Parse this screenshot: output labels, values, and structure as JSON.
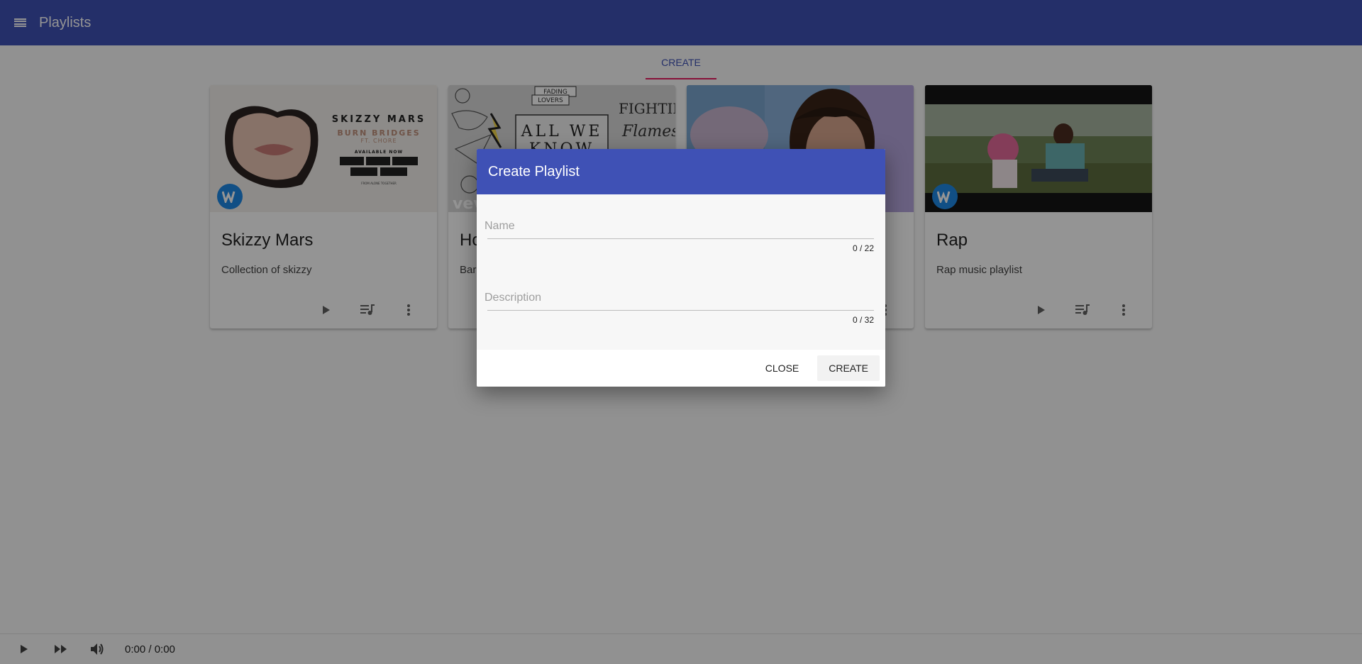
{
  "appbar": {
    "title": "Playlists",
    "menu_icon": "menu-icon"
  },
  "tabs": [
    {
      "label": "CREATE",
      "active": true
    }
  ],
  "cards": [
    {
      "title": "Skizzy Mars",
      "description": "Collection of skizzy",
      "art": {
        "heading": "SKIZZY MARS",
        "sub1": "BURN BRIDGES",
        "sub2": "FT. CHORE",
        "avail": "AVAILABLE NOW",
        "foot": "FROM ALONE TOGETHER"
      }
    },
    {
      "title": "Ho",
      "description": "Bar",
      "art": {
        "line1": "ALL WE",
        "line2": "KNOW",
        "tag1": "FADING",
        "tag2": "LOVERS",
        "tag3": "FIGHTING",
        "tag4": "Flames",
        "logo": "vev"
      }
    },
    {
      "title": "",
      "description": ""
    },
    {
      "title": "Rap",
      "description": "Rap music playlist"
    }
  ],
  "card_actions": {
    "play": "play-icon",
    "queue": "playlist-add-icon",
    "more": "more-vert-icon"
  },
  "player": {
    "time": "0:00 / 0:00"
  },
  "dialog": {
    "title": "Create Playlist",
    "name_field": {
      "placeholder": "Name",
      "value": "",
      "counter": "0 / 22"
    },
    "description_field": {
      "placeholder": "Description",
      "value": "",
      "counter": "0 / 32"
    },
    "close_label": "CLOSE",
    "create_label": "CREATE"
  },
  "colors": {
    "primary": "#3f51b5",
    "accent": "#e91e63",
    "badge": "#1e88e5"
  }
}
